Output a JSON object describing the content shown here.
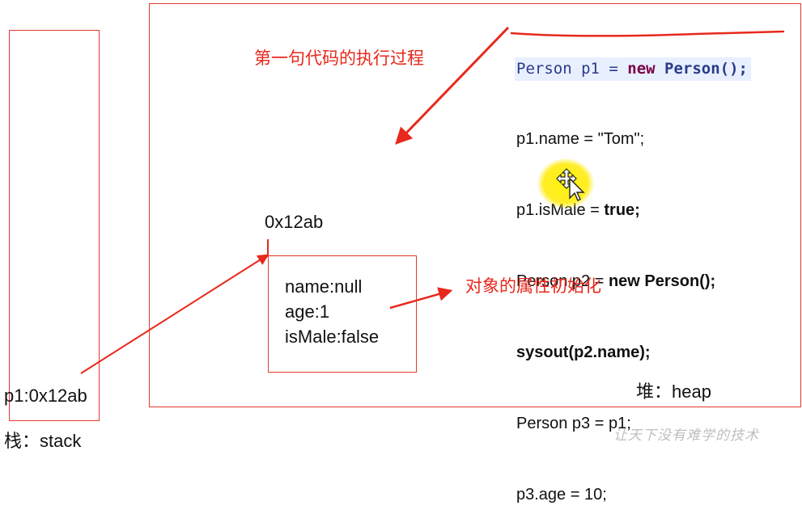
{
  "heap": {
    "label": "堆：heap",
    "code_lines": [
      "Person p1 = new Person();",
      "p1.name = \"Tom\";",
      "p1.isMale = true;",
      "Person p2 = new Person();",
      "sysout(p2.name);",
      "Person p3 = p1;",
      "p3.age = 10;"
    ],
    "code_line0_parts": [
      "Person p1 = ",
      "new",
      " Person();"
    ],
    "code_line2_parts": [
      "p1.isMale = ",
      "true;"
    ],
    "code_line3_parts": [
      "Person p2 = ",
      "new Person();"
    ],
    "annotation_first_statement": "第一句代码的执行过程",
    "annotation_attr_init": "对象的属性初始化",
    "object_address": "0x12ab",
    "object_attributes": [
      "name:null",
      "age:1",
      "isMale:false"
    ]
  },
  "stack": {
    "label": "栈：stack",
    "reference": "p1:0x12ab"
  },
  "watermark": "让天下没有难学的技术",
  "colors": {
    "accent_red": "#e23a2e",
    "code_highlight": "#e8f0ff",
    "keyword": "#7a0044",
    "cursor_highlight": "#ffee00"
  },
  "icons": [
    "move-cursor-icon"
  ]
}
